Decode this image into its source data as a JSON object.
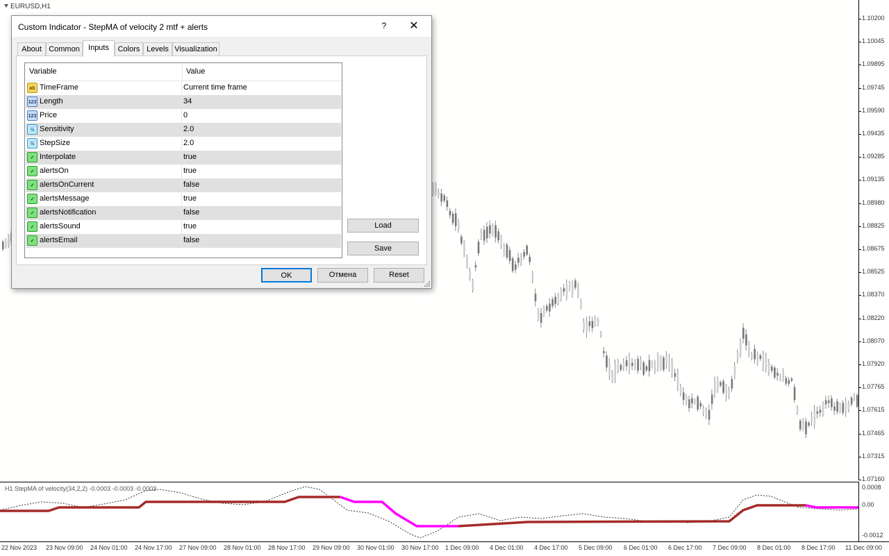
{
  "chart": {
    "symbol": "EURUSD,H1",
    "price_labels": [
      "1.10200",
      "1.10045",
      "1.09895",
      "1.09745",
      "1.09590",
      "1.09435",
      "1.09285",
      "1.09135",
      "1.08980",
      "1.08825",
      "1.08675",
      "1.08525",
      "1.08370",
      "1.08220",
      "1.08070",
      "1.07920",
      "1.07765",
      "1.07615",
      "1.07465",
      "1.07315",
      "1.07160"
    ],
    "time_labels": [
      "22 Nov 2023",
      "23 Nov 09:00",
      "24 Nov 01:00",
      "24 Nov 17:00",
      "27 Nov 09:00",
      "28 Nov 01:00",
      "28 Nov 17:00",
      "29 Nov 09:00",
      "30 Nov 01:00",
      "30 Nov 17:00",
      "1 Dec 09:00",
      "4 Dec 01:00",
      "4 Dec 17:00",
      "5 Dec 09:00",
      "6 Dec 01:00",
      "6 Dec 17:00",
      "7 Dec 09:00",
      "8 Dec 01:00",
      "8 Dec 17:00",
      "11 Dec 09:00"
    ],
    "candle_color": "#777777",
    "bg_color": "#fffffe"
  },
  "indicator": {
    "title": "H1 StepMA of velocity(34,2,2) -0.0003 -0.0003 -0.0003",
    "scale_labels": [
      "0.0008",
      "0.00",
      "-0.0012"
    ],
    "up_color": "#a52a2a",
    "down_color": "#ff00ff"
  },
  "dialog": {
    "title": "Custom Indicator - StepMA of velocity 2 mtf + alerts",
    "help": "?",
    "close": "✕",
    "tabs": [
      "About",
      "Common",
      "Inputs",
      "Colors",
      "Levels",
      "Visualization"
    ],
    "active_tab": "Inputs",
    "grid": {
      "col_variable": "Variable",
      "col_value": "Value",
      "rows": [
        {
          "type": "ab",
          "name": "TimeFrame",
          "value": "Current time frame"
        },
        {
          "type": "123",
          "name": "Length",
          "value": "34"
        },
        {
          "type": "123",
          "name": "Price",
          "value": "0"
        },
        {
          "type": "v2",
          "name": "Sensitivity",
          "value": "2.0"
        },
        {
          "type": "v2",
          "name": "StepSize",
          "value": "2.0"
        },
        {
          "type": "bool",
          "name": "Interpolate",
          "value": "true"
        },
        {
          "type": "bool",
          "name": "alertsOn",
          "value": "true"
        },
        {
          "type": "bool",
          "name": "alertsOnCurrent",
          "value": "false"
        },
        {
          "type": "bool",
          "name": "alertsMessage",
          "value": "true"
        },
        {
          "type": "bool",
          "name": "alertsNotification",
          "value": "false"
        },
        {
          "type": "bool",
          "name": "alertsSound",
          "value": "true"
        },
        {
          "type": "bool",
          "name": "alertsEmail",
          "value": "false"
        }
      ]
    },
    "buttons": {
      "load": "Load",
      "save": "Save",
      "ok": "OK",
      "cancel": "Отмена",
      "reset": "Reset"
    }
  }
}
